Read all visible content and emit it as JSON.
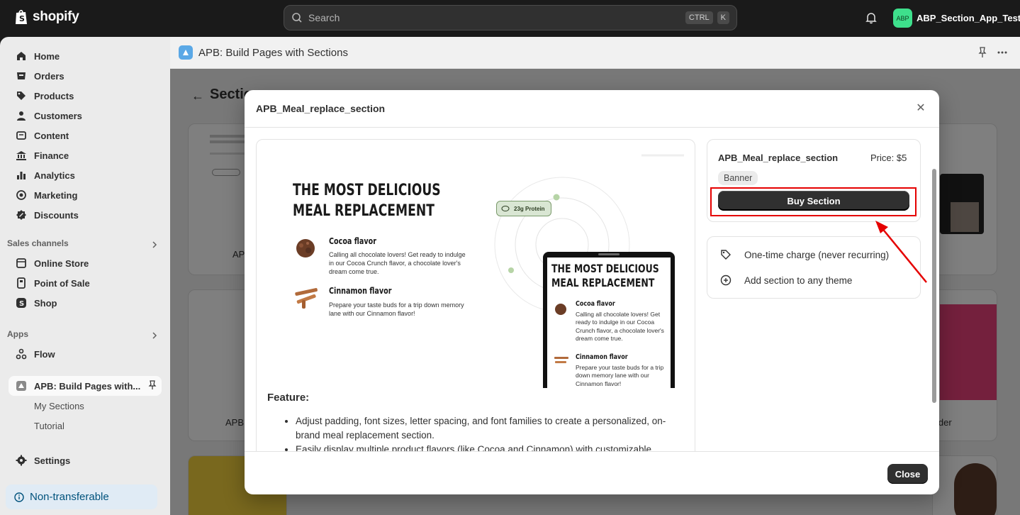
{
  "topbar": {
    "logo_text": "shopify",
    "search_placeholder": "Search",
    "kbd_ctrl": "CTRL",
    "kbd_k": "K",
    "store_avatar": "ABP",
    "store_name": "ABP_Section_App_Test"
  },
  "sidebar": {
    "items": [
      {
        "label": "Home",
        "icon": "home-icon"
      },
      {
        "label": "Orders",
        "icon": "orders-icon"
      },
      {
        "label": "Products",
        "icon": "tag-icon"
      },
      {
        "label": "Customers",
        "icon": "person-icon"
      },
      {
        "label": "Content",
        "icon": "content-icon"
      },
      {
        "label": "Finance",
        "icon": "bank-icon"
      },
      {
        "label": "Analytics",
        "icon": "bar-chart-icon"
      },
      {
        "label": "Marketing",
        "icon": "target-icon"
      },
      {
        "label": "Discounts",
        "icon": "discount-icon"
      }
    ],
    "sales_channels_label": "Sales channels",
    "channels": [
      {
        "label": "Online Store",
        "icon": "store-icon"
      },
      {
        "label": "Point of Sale",
        "icon": "pos-icon"
      },
      {
        "label": "Shop",
        "icon": "shop-icon"
      }
    ],
    "apps_label": "Apps",
    "apps": [
      {
        "label": "Flow",
        "icon": "flow-icon"
      },
      {
        "label": "APB: Build Pages with...",
        "icon": "app-icon"
      }
    ],
    "app_subitems": [
      "My Sections",
      "Tutorial"
    ],
    "settings_label": "Settings",
    "non_transferable": "Non-transferable"
  },
  "appbar": {
    "title": "APB: Build Pages with Sections"
  },
  "page": {
    "heading": "Sectio",
    "card_labels": [
      "APB",
      "APB",
      "ider"
    ]
  },
  "modal": {
    "title": "APB_Meal_replace_section",
    "preview": {
      "heading": "THE MOST DELICIOUS MEAL REPLACEMENT",
      "protein": "23g Protein",
      "flavors": [
        {
          "name": "Cocoa flavor",
          "desc": "Calling all chocolate lovers! Get ready to indulge in our Cocoa Crunch flavor, a chocolate lover's dream come true."
        },
        {
          "name": "Cinnamon flavor",
          "desc": "Prepare your taste buds for a trip down memory lane with our Cinnamon flavor!"
        }
      ]
    },
    "feature_title": "Feature:",
    "features": [
      "Adjust padding, font sizes, letter spacing, and font families to create a personalized, on-brand meal replacement section.",
      "Easily display multiple product flavors (like Cocoa and Cinnamon) with customizable"
    ],
    "info": {
      "name": "APB_Meal_replace_section",
      "price": "Price: $5",
      "badge": "Banner",
      "buy_label": "Buy Section"
    },
    "perks": [
      {
        "label": "One-time charge (never recurring)",
        "icon": "tag-icon"
      },
      {
        "label": "Add section to any theme",
        "icon": "plus-circle-icon"
      }
    ],
    "close_label": "Close"
  },
  "colors": {
    "accent_highlight": "#e50000",
    "primary_button": "#303030",
    "avatar_bg": "#3ee08c"
  }
}
